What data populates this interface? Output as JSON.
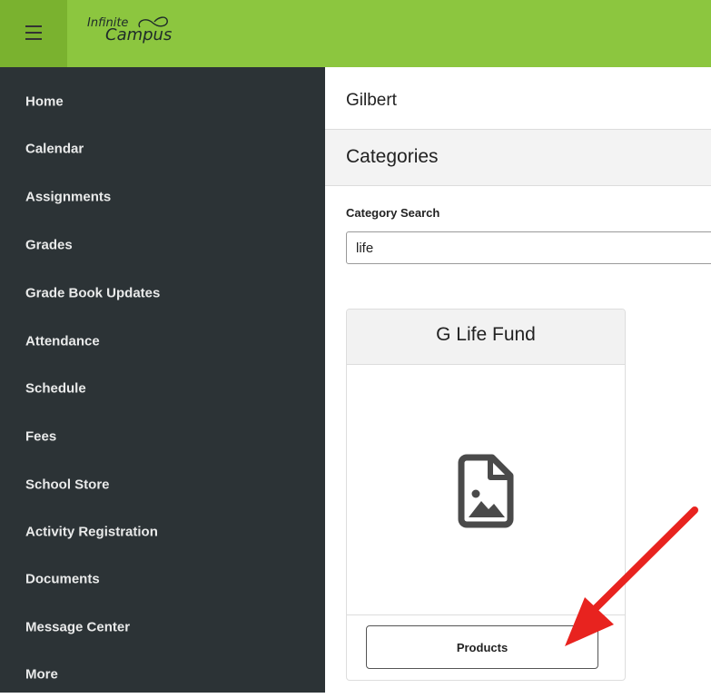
{
  "brand": {
    "logo_top": "Infinite",
    "logo_bottom": "Campus",
    "accent": "#8cc63f"
  },
  "sidebar": {
    "items": [
      {
        "label": "Home"
      },
      {
        "label": "Calendar"
      },
      {
        "label": "Assignments"
      },
      {
        "label": "Grades"
      },
      {
        "label": "Grade Book Updates"
      },
      {
        "label": "Attendance"
      },
      {
        "label": "Schedule"
      },
      {
        "label": "Fees"
      },
      {
        "label": "School Store"
      },
      {
        "label": "Activity Registration"
      },
      {
        "label": "Documents"
      },
      {
        "label": "Message Center"
      },
      {
        "label": "More"
      }
    ]
  },
  "main": {
    "school_name": "Gilbert",
    "section_title": "Categories",
    "search": {
      "label": "Category Search",
      "value": "life"
    },
    "card": {
      "title": "G Life Fund",
      "icon": "image-file-icon",
      "button_label": "Products"
    }
  },
  "annotation": {
    "arrow_color": "#e8231f"
  }
}
